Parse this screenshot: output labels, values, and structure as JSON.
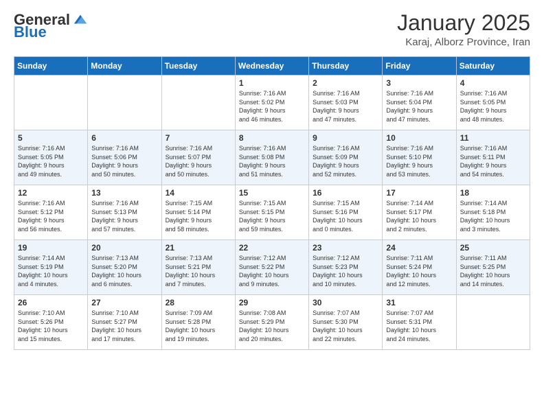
{
  "header": {
    "logo_general": "General",
    "logo_blue": "Blue",
    "month_title": "January 2025",
    "location": "Karaj, Alborz Province, Iran"
  },
  "weekdays": [
    "Sunday",
    "Monday",
    "Tuesday",
    "Wednesday",
    "Thursday",
    "Friday",
    "Saturday"
  ],
  "weeks": [
    [
      {
        "day": "",
        "info": ""
      },
      {
        "day": "",
        "info": ""
      },
      {
        "day": "",
        "info": ""
      },
      {
        "day": "1",
        "info": "Sunrise: 7:16 AM\nSunset: 5:02 PM\nDaylight: 9 hours\nand 46 minutes."
      },
      {
        "day": "2",
        "info": "Sunrise: 7:16 AM\nSunset: 5:03 PM\nDaylight: 9 hours\nand 47 minutes."
      },
      {
        "day": "3",
        "info": "Sunrise: 7:16 AM\nSunset: 5:04 PM\nDaylight: 9 hours\nand 47 minutes."
      },
      {
        "day": "4",
        "info": "Sunrise: 7:16 AM\nSunset: 5:05 PM\nDaylight: 9 hours\nand 48 minutes."
      }
    ],
    [
      {
        "day": "5",
        "info": "Sunrise: 7:16 AM\nSunset: 5:05 PM\nDaylight: 9 hours\nand 49 minutes."
      },
      {
        "day": "6",
        "info": "Sunrise: 7:16 AM\nSunset: 5:06 PM\nDaylight: 9 hours\nand 50 minutes."
      },
      {
        "day": "7",
        "info": "Sunrise: 7:16 AM\nSunset: 5:07 PM\nDaylight: 9 hours\nand 50 minutes."
      },
      {
        "day": "8",
        "info": "Sunrise: 7:16 AM\nSunset: 5:08 PM\nDaylight: 9 hours\nand 51 minutes."
      },
      {
        "day": "9",
        "info": "Sunrise: 7:16 AM\nSunset: 5:09 PM\nDaylight: 9 hours\nand 52 minutes."
      },
      {
        "day": "10",
        "info": "Sunrise: 7:16 AM\nSunset: 5:10 PM\nDaylight: 9 hours\nand 53 minutes."
      },
      {
        "day": "11",
        "info": "Sunrise: 7:16 AM\nSunset: 5:11 PM\nDaylight: 9 hours\nand 54 minutes."
      }
    ],
    [
      {
        "day": "12",
        "info": "Sunrise: 7:16 AM\nSunset: 5:12 PM\nDaylight: 9 hours\nand 56 minutes."
      },
      {
        "day": "13",
        "info": "Sunrise: 7:16 AM\nSunset: 5:13 PM\nDaylight: 9 hours\nand 57 minutes."
      },
      {
        "day": "14",
        "info": "Sunrise: 7:15 AM\nSunset: 5:14 PM\nDaylight: 9 hours\nand 58 minutes."
      },
      {
        "day": "15",
        "info": "Sunrise: 7:15 AM\nSunset: 5:15 PM\nDaylight: 9 hours\nand 59 minutes."
      },
      {
        "day": "16",
        "info": "Sunrise: 7:15 AM\nSunset: 5:16 PM\nDaylight: 10 hours\nand 0 minutes."
      },
      {
        "day": "17",
        "info": "Sunrise: 7:14 AM\nSunset: 5:17 PM\nDaylight: 10 hours\nand 2 minutes."
      },
      {
        "day": "18",
        "info": "Sunrise: 7:14 AM\nSunset: 5:18 PM\nDaylight: 10 hours\nand 3 minutes."
      }
    ],
    [
      {
        "day": "19",
        "info": "Sunrise: 7:14 AM\nSunset: 5:19 PM\nDaylight: 10 hours\nand 4 minutes."
      },
      {
        "day": "20",
        "info": "Sunrise: 7:13 AM\nSunset: 5:20 PM\nDaylight: 10 hours\nand 6 minutes."
      },
      {
        "day": "21",
        "info": "Sunrise: 7:13 AM\nSunset: 5:21 PM\nDaylight: 10 hours\nand 7 minutes."
      },
      {
        "day": "22",
        "info": "Sunrise: 7:12 AM\nSunset: 5:22 PM\nDaylight: 10 hours\nand 9 minutes."
      },
      {
        "day": "23",
        "info": "Sunrise: 7:12 AM\nSunset: 5:23 PM\nDaylight: 10 hours\nand 10 minutes."
      },
      {
        "day": "24",
        "info": "Sunrise: 7:11 AM\nSunset: 5:24 PM\nDaylight: 10 hours\nand 12 minutes."
      },
      {
        "day": "25",
        "info": "Sunrise: 7:11 AM\nSunset: 5:25 PM\nDaylight: 10 hours\nand 14 minutes."
      }
    ],
    [
      {
        "day": "26",
        "info": "Sunrise: 7:10 AM\nSunset: 5:26 PM\nDaylight: 10 hours\nand 15 minutes."
      },
      {
        "day": "27",
        "info": "Sunrise: 7:10 AM\nSunset: 5:27 PM\nDaylight: 10 hours\nand 17 minutes."
      },
      {
        "day": "28",
        "info": "Sunrise: 7:09 AM\nSunset: 5:28 PM\nDaylight: 10 hours\nand 19 minutes."
      },
      {
        "day": "29",
        "info": "Sunrise: 7:08 AM\nSunset: 5:29 PM\nDaylight: 10 hours\nand 20 minutes."
      },
      {
        "day": "30",
        "info": "Sunrise: 7:07 AM\nSunset: 5:30 PM\nDaylight: 10 hours\nand 22 minutes."
      },
      {
        "day": "31",
        "info": "Sunrise: 7:07 AM\nSunset: 5:31 PM\nDaylight: 10 hours\nand 24 minutes."
      },
      {
        "day": "",
        "info": ""
      }
    ]
  ]
}
